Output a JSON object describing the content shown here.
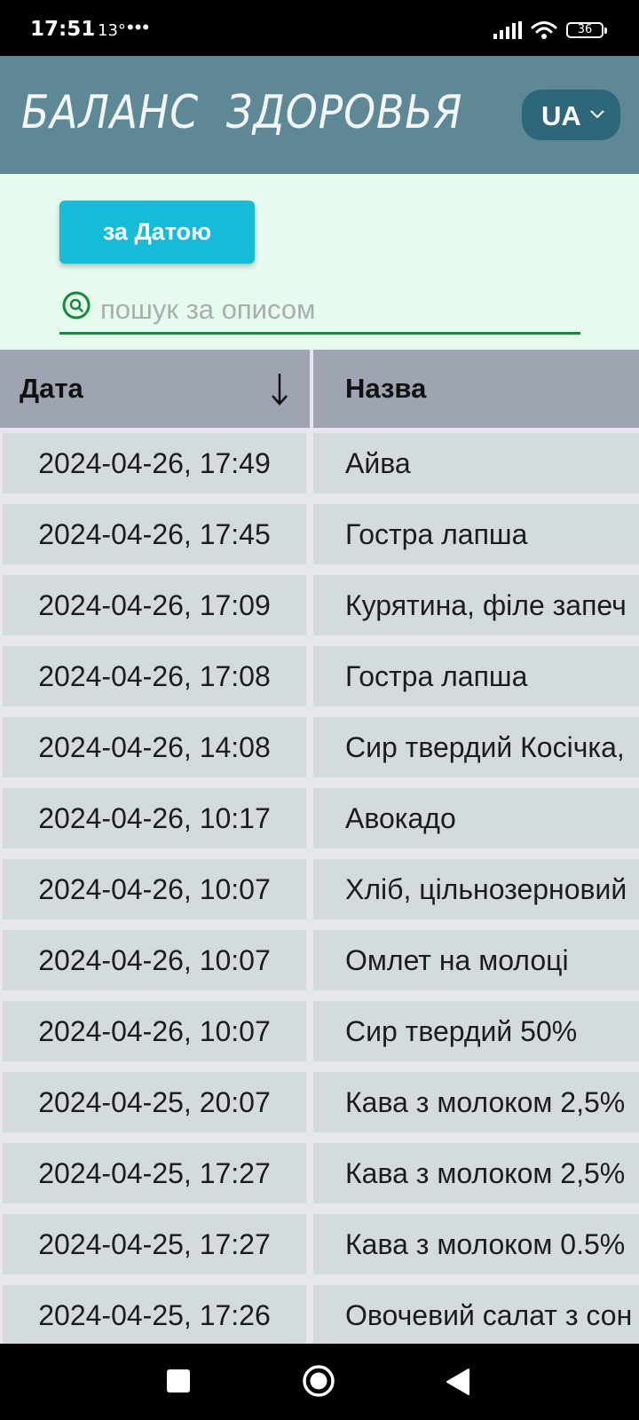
{
  "status_bar": {
    "time": "17:51",
    "temperature": "13°",
    "more": "•••",
    "battery": "36"
  },
  "header": {
    "title": "БАЛАНС  ЗДОРОВЬЯ",
    "language": "UA",
    "background_color": "#5f8896"
  },
  "filters": {
    "sort_button_label": "за Датою",
    "search_placeholder": "пошук за описом",
    "search_value": "",
    "accent_color": "#14bcd8"
  },
  "table": {
    "columns": [
      {
        "label": "Дата",
        "sort": "descending"
      },
      {
        "label": "Назва"
      }
    ],
    "rows": [
      {
        "date": "2024-04-26, 17:49",
        "name": "Айва"
      },
      {
        "date": "2024-04-26, 17:45",
        "name": "Гостра лапша"
      },
      {
        "date": "2024-04-26, 17:09",
        "name": "Курятина, філе запеч"
      },
      {
        "date": "2024-04-26, 17:08",
        "name": "Гостра лапша"
      },
      {
        "date": "2024-04-26, 14:08",
        "name": "Сир твердий Косічка,"
      },
      {
        "date": "2024-04-26, 10:17",
        "name": "Авокадо"
      },
      {
        "date": "2024-04-26, 10:07",
        "name": "Хліб, цільнозерновий"
      },
      {
        "date": "2024-04-26, 10:07",
        "name": "Омлет на молоці"
      },
      {
        "date": "2024-04-26, 10:07",
        "name": "Сир твердий 50%"
      },
      {
        "date": "2024-04-25, 20:07",
        "name": "Кава з молоком 2,5%"
      },
      {
        "date": "2024-04-25, 17:27",
        "name": "Кава з молоком 2,5%"
      },
      {
        "date": "2024-04-25, 17:27",
        "name": "Кава з молоком 0.5%"
      },
      {
        "date": "2024-04-25, 17:26",
        "name": "Овочевий салат з сон"
      }
    ]
  }
}
